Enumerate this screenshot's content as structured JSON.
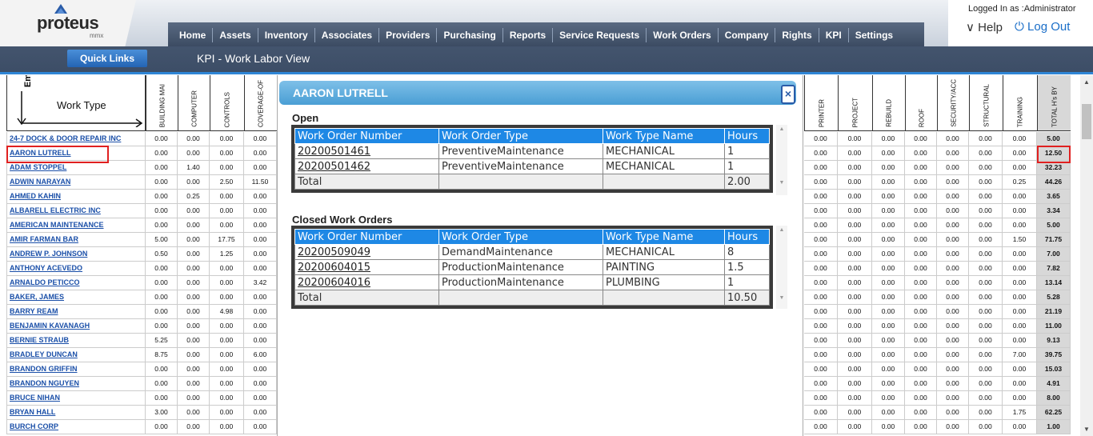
{
  "header": {
    "logo": "proteus",
    "logo_sub": "mmx",
    "logged_in": "Logged In as :Administrator",
    "help": "Help",
    "logout": "Log Out",
    "quick_links": "Quick Links",
    "page_title": "KPI - Work Labor View",
    "nav": [
      "Home",
      "Assets",
      "Inventory",
      "Associates",
      "Providers",
      "Purchasing",
      "Reports",
      "Service Requests",
      "Work Orders",
      "Company",
      "Rights",
      "KPI",
      "Settings"
    ]
  },
  "grid": {
    "corner_top": "Em",
    "corner_label": "Work Type",
    "left_columns": [
      "BUILDING MAI",
      "COMPUTER",
      "CONTROLS",
      "COVERAGE-OF"
    ],
    "right_columns": [
      "PRINTER",
      "PROJECT",
      "REBUILD",
      "ROOF",
      "SECURITY/ACC",
      "STRUCTURAL",
      "TRAINING",
      "TOTAL H's BY"
    ],
    "rows": [
      {
        "name": "24-7 DOCK & DOOR REPAIR INC",
        "left": [
          "0.00",
          "0.00",
          "0.00",
          "0.00"
        ],
        "right": [
          "0.00",
          "0.00",
          "0.00",
          "0.00",
          "0.00",
          "0.00",
          "0.00",
          "5.00"
        ]
      },
      {
        "name": "AARON LUTRELL",
        "left": [
          "0.00",
          "0.00",
          "0.00",
          "0.00"
        ],
        "right": [
          "0.00",
          "0.00",
          "0.00",
          "0.00",
          "0.00",
          "0.00",
          "0.00",
          "12.50"
        ]
      },
      {
        "name": "ADAM STOPPEL",
        "left": [
          "0.00",
          "1.40",
          "0.00",
          "0.00"
        ],
        "right": [
          "0.00",
          "0.00",
          "0.00",
          "0.00",
          "0.00",
          "0.00",
          "0.00",
          "32.23"
        ]
      },
      {
        "name": "ADWIN NARAYAN",
        "left": [
          "0.00",
          "0.00",
          "2.50",
          "11.50"
        ],
        "right": [
          "0.00",
          "0.00",
          "0.00",
          "0.00",
          "0.00",
          "0.00",
          "0.25",
          "44.26"
        ]
      },
      {
        "name": "AHMED KAHIN",
        "left": [
          "0.00",
          "0.25",
          "0.00",
          "0.00"
        ],
        "right": [
          "0.00",
          "0.00",
          "0.00",
          "0.00",
          "0.00",
          "0.00",
          "0.00",
          "3.65"
        ]
      },
      {
        "name": "ALBARELL ELECTRIC INC",
        "left": [
          "0.00",
          "0.00",
          "0.00",
          "0.00"
        ],
        "right": [
          "0.00",
          "0.00",
          "0.00",
          "0.00",
          "0.00",
          "0.00",
          "0.00",
          "3.34"
        ]
      },
      {
        "name": "AMERICAN MAINTENANCE",
        "left": [
          "0.00",
          "0.00",
          "0.00",
          "0.00"
        ],
        "right": [
          "0.00",
          "0.00",
          "0.00",
          "0.00",
          "0.00",
          "0.00",
          "0.00",
          "5.00"
        ]
      },
      {
        "name": "AMIR FARMAN BAR",
        "left": [
          "5.00",
          "0.00",
          "17.75",
          "0.00"
        ],
        "right": [
          "0.00",
          "0.00",
          "0.00",
          "0.00",
          "0.00",
          "0.00",
          "1.50",
          "71.75"
        ]
      },
      {
        "name": "ANDREW P. JOHNSON",
        "left": [
          "0.50",
          "0.00",
          "1.25",
          "0.00"
        ],
        "right": [
          "0.00",
          "0.00",
          "0.00",
          "0.00",
          "0.00",
          "0.00",
          "0.00",
          "7.00"
        ]
      },
      {
        "name": "ANTHONY ACEVEDO",
        "left": [
          "0.00",
          "0.00",
          "0.00",
          "0.00"
        ],
        "right": [
          "0.00",
          "0.00",
          "0.00",
          "0.00",
          "0.00",
          "0.00",
          "0.00",
          "7.82"
        ]
      },
      {
        "name": "ARNALDO PETICCO",
        "left": [
          "0.00",
          "0.00",
          "0.00",
          "3.42"
        ],
        "right": [
          "0.00",
          "0.00",
          "0.00",
          "0.00",
          "0.00",
          "0.00",
          "0.00",
          "13.14"
        ]
      },
      {
        "name": "BAKER, JAMES",
        "left": [
          "0.00",
          "0.00",
          "0.00",
          "0.00"
        ],
        "right": [
          "0.00",
          "0.00",
          "0.00",
          "0.00",
          "0.00",
          "0.00",
          "0.00",
          "5.28"
        ]
      },
      {
        "name": "BARRY REAM",
        "left": [
          "0.00",
          "0.00",
          "4.98",
          "0.00"
        ],
        "right": [
          "0.00",
          "0.00",
          "0.00",
          "0.00",
          "0.00",
          "0.00",
          "0.00",
          "21.19"
        ]
      },
      {
        "name": "BENJAMIN KAVANAGH",
        "left": [
          "0.00",
          "0.00",
          "0.00",
          "0.00"
        ],
        "right": [
          "0.00",
          "0.00",
          "0.00",
          "0.00",
          "0.00",
          "0.00",
          "0.00",
          "11.00"
        ]
      },
      {
        "name": "BERNIE STRAUB",
        "left": [
          "5.25",
          "0.00",
          "0.00",
          "0.00"
        ],
        "right": [
          "0.00",
          "0.00",
          "0.00",
          "0.00",
          "0.00",
          "0.00",
          "0.00",
          "9.13"
        ]
      },
      {
        "name": "BRADLEY DUNCAN",
        "left": [
          "8.75",
          "0.00",
          "0.00",
          "6.00"
        ],
        "right": [
          "0.00",
          "0.00",
          "0.00",
          "0.00",
          "0.00",
          "0.00",
          "7.00",
          "39.75"
        ]
      },
      {
        "name": "BRANDON GRIFFIN",
        "left": [
          "0.00",
          "0.00",
          "0.00",
          "0.00"
        ],
        "right": [
          "0.00",
          "0.00",
          "0.00",
          "0.00",
          "0.00",
          "0.00",
          "0.00",
          "15.03"
        ]
      },
      {
        "name": "BRANDON NGUYEN",
        "left": [
          "0.00",
          "0.00",
          "0.00",
          "0.00"
        ],
        "right": [
          "0.00",
          "0.00",
          "0.00",
          "0.00",
          "0.00",
          "0.00",
          "0.00",
          "4.91"
        ]
      },
      {
        "name": "BRUCE NIHAN",
        "left": [
          "0.00",
          "0.00",
          "0.00",
          "0.00"
        ],
        "right": [
          "0.00",
          "0.00",
          "0.00",
          "0.00",
          "0.00",
          "0.00",
          "0.00",
          "8.00"
        ]
      },
      {
        "name": "BRYAN HALL",
        "left": [
          "3.00",
          "0.00",
          "0.00",
          "0.00"
        ],
        "right": [
          "0.00",
          "0.00",
          "0.00",
          "0.00",
          "0.00",
          "0.00",
          "1.75",
          "62.25"
        ]
      },
      {
        "name": "BURCH CORP",
        "left": [
          "0.00",
          "0.00",
          "0.00",
          "0.00"
        ],
        "right": [
          "0.00",
          "0.00",
          "0.00",
          "0.00",
          "0.00",
          "0.00",
          "0.00",
          "1.00"
        ]
      }
    ]
  },
  "modal": {
    "title": "AARON LUTRELL",
    "close": "×",
    "open_label": "Open",
    "closed_label": "Closed Work Orders",
    "columns": [
      "Work Order Number",
      "Work Order Type",
      "Work Type Name",
      "Hours"
    ],
    "open_rows": [
      [
        "20200501461",
        "PreventiveMaintenance",
        "MECHANICAL",
        "1"
      ],
      [
        "20200501462",
        "PreventiveMaintenance",
        "MECHANICAL",
        "1"
      ]
    ],
    "open_total": [
      "Total",
      "",
      "",
      "2.00"
    ],
    "closed_rows": [
      [
        "20200509049",
        "DemandMaintenance",
        "MECHANICAL",
        "8"
      ],
      [
        "20200604015",
        "ProductionMaintenance",
        "PAINTING",
        "1.5"
      ],
      [
        "20200604016",
        "ProductionMaintenance",
        "PLUMBING",
        "1"
      ]
    ],
    "closed_total": [
      "Total",
      "",
      "",
      "10.50"
    ]
  }
}
